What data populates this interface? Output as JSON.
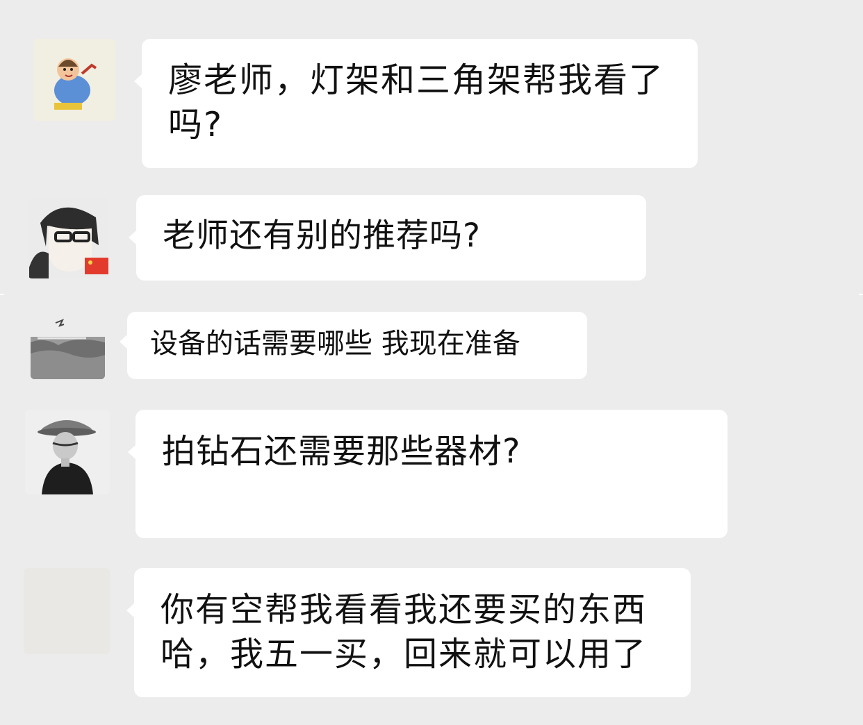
{
  "messages": [
    {
      "text": "廖老师，灯架和三角架帮我看了吗?",
      "avatar_icon": "cartoon-man-avatar"
    },
    {
      "text": "老师还有别的推荐吗?",
      "avatar_icon": "cartoon-glasses-avatar"
    },
    {
      "text": "设备的话需要哪些 我现在准备",
      "avatar_icon": "landscape-bird-avatar"
    },
    {
      "text": "拍钻石还需要那些器材?",
      "avatar_icon": "hat-man-avatar"
    },
    {
      "text": "你有空帮我看看我还要买的东西哈，我五一买，回来就可以用了",
      "avatar_icon": "blank-avatar"
    }
  ],
  "colors": {
    "background": "#ececec",
    "bubble": "#ffffff",
    "text": "#111111"
  }
}
